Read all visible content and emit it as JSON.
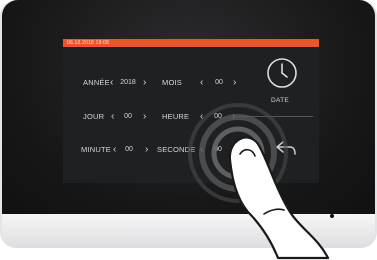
{
  "status_bar": {
    "datetime": "06.10.2018  19:08"
  },
  "rows": [
    {
      "label": "ANNÉE",
      "value": "2018",
      "label2": "MOIS",
      "value2": "00"
    },
    {
      "label": "JOUR",
      "value": "00",
      "label2": "HEURE",
      "value2": "00"
    },
    {
      "label": "MINUTE",
      "value": "00",
      "label2": "SECONDE",
      "value2": "00"
    }
  ],
  "date_button": {
    "label": "DATE",
    "icon": "clock-icon"
  },
  "back_button": {
    "icon": "back-arrow-icon"
  },
  "colors": {
    "accent": "#e8562a",
    "screen_bg": "#1f2022",
    "text": "#d8d8d8"
  }
}
